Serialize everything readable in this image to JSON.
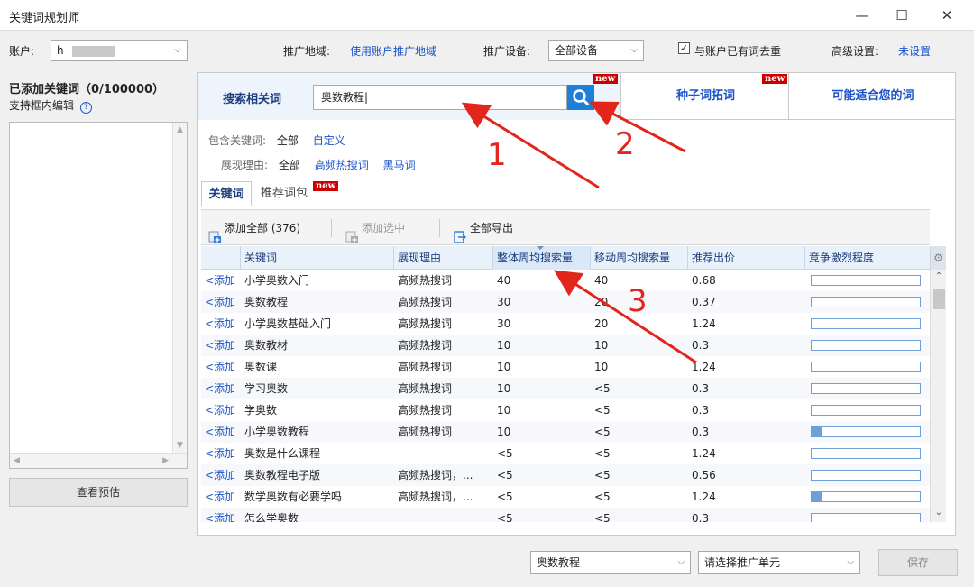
{
  "window": {
    "title": "关键词规划师",
    "min_glyph": "—",
    "max_glyph": "☐",
    "close_glyph": "✕"
  },
  "topbar": {
    "account_label": "账户:",
    "account_value": "h",
    "region_label": "推广地域:",
    "region_value": "使用账户推广地域",
    "device_label": "推广设备:",
    "device_value": "全部设备",
    "dedupe_label": "与账户已有词去重",
    "dedupe_checked": true,
    "advanced_label": "高级设置:",
    "advanced_value": "未设置"
  },
  "left": {
    "added_title": "已添加关键词（0/100000）",
    "inline_edit_label": "支持框内编辑",
    "help_glyph": "?",
    "preview_button": "查看预估"
  },
  "tabs_top": [
    {
      "label": "搜索相关词",
      "active": true
    },
    {
      "label": "种子词拓词",
      "badge": "new"
    },
    {
      "label": "可能适合您的词"
    }
  ],
  "search": {
    "value": "奥数教程|",
    "badge": "new"
  },
  "filters": {
    "include_label": "包含关键词:",
    "include_all": "全部",
    "include_custom": "自定义",
    "reason_label": "展现理由:",
    "reason_all": "全部",
    "reason_hot": "高频热搜词",
    "reason_dark": "黑马词"
  },
  "subtabs": [
    {
      "label": "关键词",
      "active": true
    },
    {
      "label": "推荐词包",
      "badge": "new"
    }
  ],
  "toolbar": {
    "add_all": "添加全部 (376)",
    "add_selected": "添加选中",
    "export_all": "全部导出"
  },
  "table": {
    "headers": [
      "",
      "关键词",
      "展现理由",
      "整体周均搜索量",
      "移动周均搜索量",
      "推荐出价",
      "竞争激烈程度"
    ],
    "add_label": "<添加",
    "rows": [
      {
        "kw": "小学奥数入门",
        "reason": "高频热搜词",
        "overall": "40",
        "mobile": "40",
        "bid": "0.68",
        "comp": 0.0
      },
      {
        "kw": "奥数教程",
        "reason": "高频热搜词",
        "overall": "30",
        "mobile": "20",
        "bid": "0.37",
        "comp": 0.0
      },
      {
        "kw": "小学奥数基础入门",
        "reason": "高频热搜词",
        "overall": "30",
        "mobile": "20",
        "bid": "1.24",
        "comp": 0.0
      },
      {
        "kw": "奥数教材",
        "reason": "高频热搜词",
        "overall": "10",
        "mobile": "10",
        "bid": "0.3",
        "comp": 0.0
      },
      {
        "kw": "奥数课",
        "reason": "高频热搜词",
        "overall": "10",
        "mobile": "10",
        "bid": "1.24",
        "comp": 0.0
      },
      {
        "kw": "学习奥数",
        "reason": "高频热搜词",
        "overall": "10",
        "mobile": "<5",
        "bid": "0.3",
        "comp": 0.0
      },
      {
        "kw": "学奥数",
        "reason": "高频热搜词",
        "overall": "10",
        "mobile": "<5",
        "bid": "0.3",
        "comp": 0.0
      },
      {
        "kw": "小学奥数教程",
        "reason": "高频热搜词",
        "overall": "10",
        "mobile": "<5",
        "bid": "0.3",
        "comp": 0.01
      },
      {
        "kw": "奥数是什么课程",
        "reason": "",
        "overall": "<5",
        "mobile": "<5",
        "bid": "1.24",
        "comp": 0.0
      },
      {
        "kw": "奥数教程电子版",
        "reason": "高频热搜词，...",
        "overall": "<5",
        "mobile": "<5",
        "bid": "0.56",
        "comp": 0.0
      },
      {
        "kw": "数学奥数有必要学吗",
        "reason": "高频热搜词，...",
        "overall": "<5",
        "mobile": "<5",
        "bid": "1.24",
        "comp": 0.01
      },
      {
        "kw": "怎么学奥数",
        "reason": "",
        "overall": "<5",
        "mobile": "<5",
        "bid": "0.3",
        "comp": 0.0
      }
    ]
  },
  "bottom": {
    "keyword_select": "奥数教程",
    "unit_select": "请选择推广单元",
    "save_button": "保存"
  },
  "annotations": [
    "1",
    "2",
    "3"
  ],
  "colors": {
    "link": "#1a52c9",
    "search_btn": "#1e7fd9",
    "badge": "#cc0000",
    "arrow": "#e3261c"
  }
}
